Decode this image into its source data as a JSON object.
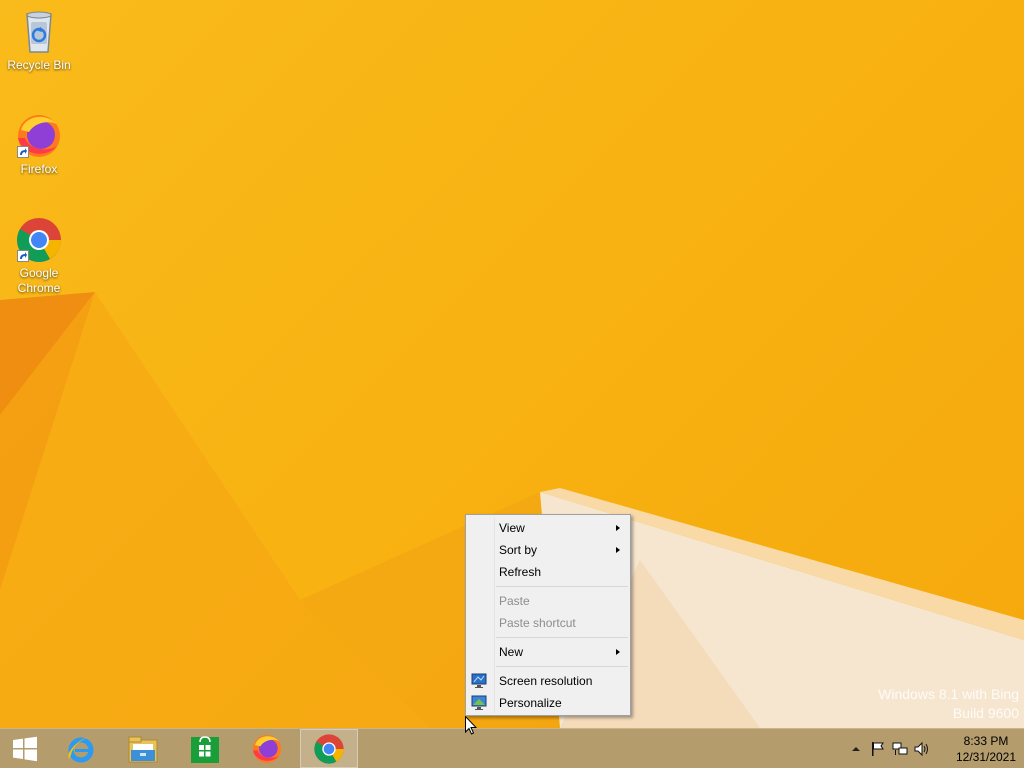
{
  "desktop": {
    "icons": [
      {
        "label": "Recycle Bin",
        "icon": "recycle-bin-icon"
      },
      {
        "label": "Firefox",
        "icon": "firefox-icon"
      },
      {
        "label": "Google Chrome",
        "icon": "chrome-icon"
      }
    ],
    "watermark": {
      "line1": "Windows 8.1 with Bing",
      "line2": "Build 9600"
    },
    "colors": {
      "wallpaper": "#f8b312",
      "taskbar": "#b49c6c"
    }
  },
  "context_menu": {
    "items": [
      {
        "label": "View",
        "has_submenu": true,
        "disabled": false
      },
      {
        "label": "Sort by",
        "has_submenu": true,
        "disabled": false
      },
      {
        "label": "Refresh",
        "has_submenu": false,
        "disabled": false
      },
      {
        "label": "Paste",
        "has_submenu": false,
        "disabled": true
      },
      {
        "label": "Paste shortcut",
        "has_submenu": false,
        "disabled": true
      },
      {
        "label": "New",
        "has_submenu": true,
        "disabled": false
      },
      {
        "label": "Screen resolution",
        "has_submenu": false,
        "disabled": false,
        "icon": "screen-resolution-icon"
      },
      {
        "label": "Personalize",
        "has_submenu": false,
        "disabled": false,
        "icon": "personalize-icon"
      }
    ]
  },
  "taskbar": {
    "pinned": [
      {
        "name": "Start",
        "icon": "windows-start-icon"
      },
      {
        "name": "Internet Explorer",
        "icon": "internet-explorer-icon"
      },
      {
        "name": "File Explorer",
        "icon": "file-explorer-icon"
      },
      {
        "name": "Store",
        "icon": "store-icon"
      },
      {
        "name": "Firefox",
        "icon": "firefox-icon"
      },
      {
        "name": "Google Chrome",
        "icon": "chrome-icon",
        "active": true
      }
    ],
    "tray": {
      "icons": [
        "show-hidden-icons-chevron",
        "action-center-flag-icon",
        "network-icon",
        "volume-icon"
      ],
      "time": "8:33 PM",
      "date": "12/31/2021"
    }
  }
}
